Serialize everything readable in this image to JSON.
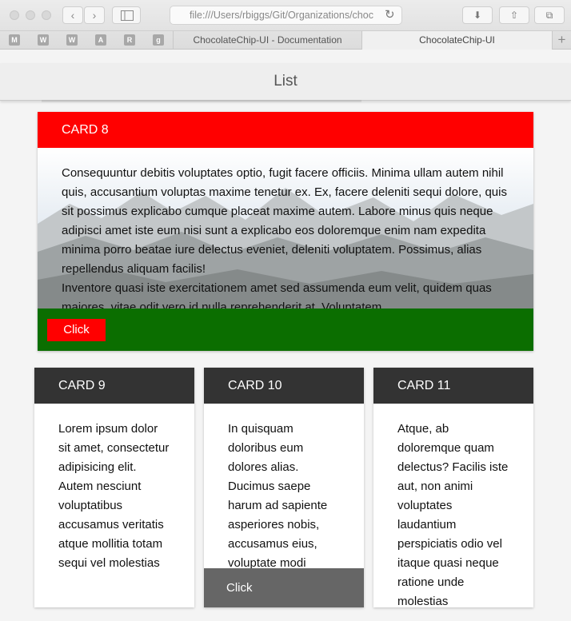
{
  "browser": {
    "url": "file:///Users/rbiggs/Git/Organizations/choc",
    "favorites": [
      "M",
      "W",
      "W",
      "A",
      "R",
      "g"
    ],
    "tabs": [
      {
        "label": "ChocolateChip-UI - Documentation",
        "active": false
      },
      {
        "label": "ChocolateChip-UI",
        "active": true
      }
    ],
    "new_tab_label": "+"
  },
  "app": {
    "title": "List"
  },
  "cards": {
    "card8": {
      "title": "CARD 8",
      "header_color": "#ff0000",
      "footer_color": "#0b6e00",
      "body": "Consequuntur debitis voluptates optio, fugit facere officiis. Minima ullam autem nihil quis, accusantium voluptas maxime tenetur ex. Ex, facere deleniti sequi dolore, quis sit possimus explicabo cumque placeat maxime autem. Labore minus quis neque adipisci amet iste eum nisi sunt a explicabo eos doloremque enim nam expedita minima porro beatae iure delectus eveniet, deleniti voluptatem. Possimus, alias repellendus aliquam facilis!",
      "body2": "Inventore quasi iste exercitationem amet sed assumenda eum velit, quidem quas maiores, vitae odit vero id nulla reprehenderit at. Voluptatem",
      "button_label": "Click"
    },
    "card9": {
      "title": "CARD 9",
      "body": "Lorem ipsum dolor sit amet, consectetur adipisicing elit. Autem nesciunt voluptatibus accusamus veritatis atque mollitia totam sequi vel molestias"
    },
    "card10": {
      "title": "CARD 10",
      "body": "In quisquam doloribus eum dolores alias. Ducimus saepe harum ad sapiente asperiores nobis, accusamus eius, voluptate modi",
      "footer_label": "Click"
    },
    "card11": {
      "title": "CARD 11",
      "body": "Atque, ab doloremque quam delectus? Facilis iste aut, non animi voluptates laudantium perspiciatis odio vel itaque quasi neque ratione unde molestias"
    }
  }
}
